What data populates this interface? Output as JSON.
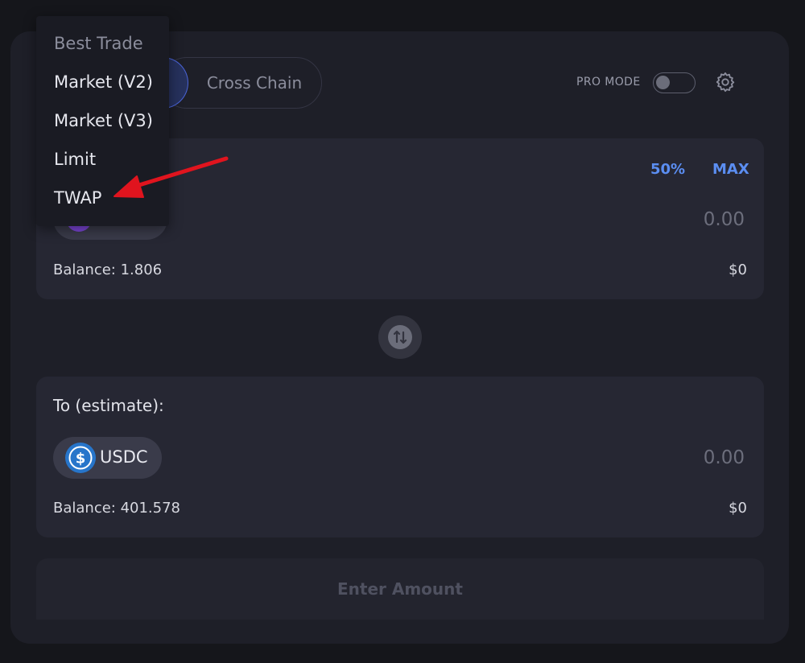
{
  "trade_modes": {
    "cross_chain_label": "Cross Chain"
  },
  "settings": {
    "pro_mode_label": "PRO MODE",
    "pro_mode_enabled": false
  },
  "from_panel": {
    "percent_50_label": "50%",
    "max_label": "MAX",
    "amount_placeholder": "0.00",
    "balance_text": "Balance: 1.806",
    "usd_value": "$0"
  },
  "to_panel": {
    "label": "To (estimate):",
    "token_symbol": "USDC",
    "amount_placeholder": "0.00",
    "balance_text": "Balance: 401.578",
    "usd_value": "$0"
  },
  "action_button": {
    "label": "Enter Amount"
  },
  "dropdown": {
    "header": "Best Trade",
    "items": [
      "Market (V2)",
      "Market (V3)",
      "Limit",
      "TWAP"
    ]
  },
  "colors": {
    "accent": "#5b8ef2",
    "annotation_arrow": "#e0141e",
    "usdc_blue": "#2775ca"
  },
  "icons": {
    "settings": "gear-icon",
    "swap": "swap-arrows-icon",
    "usdc": "usdc-token-icon"
  }
}
